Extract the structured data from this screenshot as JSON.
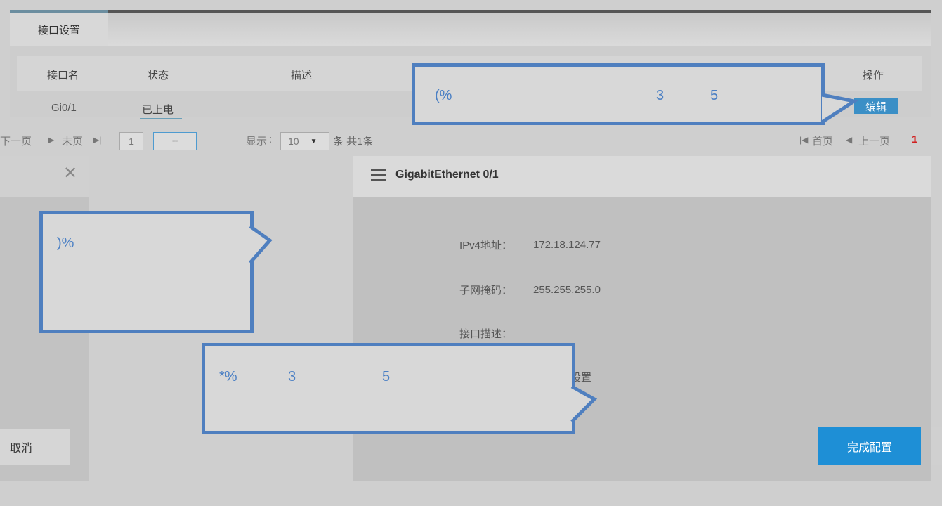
{
  "tab": {
    "label": "接口设置"
  },
  "table": {
    "headers": [
      "接口名",
      "状态",
      "描述",
      "操作"
    ],
    "row": {
      "name": "Gi0/1",
      "status": "已上电",
      "edit": "编辑"
    }
  },
  "pagination": {
    "next": "下一页",
    "last": "末页",
    "page_input": "1",
    "show_label": "显示",
    "page_size": "10",
    "count_text": "条 共1条",
    "first": "首页",
    "prev": "上一页",
    "current": "1"
  },
  "left_dialog": {
    "cancel": "取消"
  },
  "right_dialog": {
    "title": "GigabitEthernet 0/1",
    "ipv4_label": "IPv4地址：",
    "ipv4_value": "172.18.124.77",
    "mask_label": "子网掩码：",
    "mask_value": "255.255.255.0",
    "desc_label": "接口描述：",
    "more_settings": "设置",
    "done": "完成配置"
  },
  "callouts": {
    "c1": {
      "a": "(%",
      "b": "3",
      "c": "5"
    },
    "c2": {
      "a": ")%"
    },
    "c3": {
      "a": "*%",
      "b": "3",
      "c": "5"
    }
  },
  "colors": {
    "accent": "#1e8fd6",
    "callout_border": "#4f7fbf",
    "callout_text": "#4a7fc4"
  }
}
